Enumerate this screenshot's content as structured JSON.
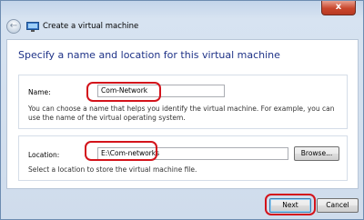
{
  "window": {
    "title": "Create a virtual machine",
    "close_glyph": "x",
    "back_glyph": "←"
  },
  "page": {
    "heading": "Specify a name and location for this virtual machine"
  },
  "name_section": {
    "label": "Name:",
    "value": "Com-Network",
    "help": "You can choose a name that helps you identify the virtual machine. For example, you can use the name of the virtual operating system."
  },
  "location_section": {
    "label": "Location:",
    "value": "E:\\Com-networks",
    "browse_label": "Browse...",
    "help": "Select a location to store the virtual machine file."
  },
  "footer": {
    "next_label": "Next",
    "cancel_label": "Cancel"
  },
  "colors": {
    "heading": "#1e3287",
    "highlight_ring": "#d3131b",
    "close_button": "#c9462c"
  }
}
